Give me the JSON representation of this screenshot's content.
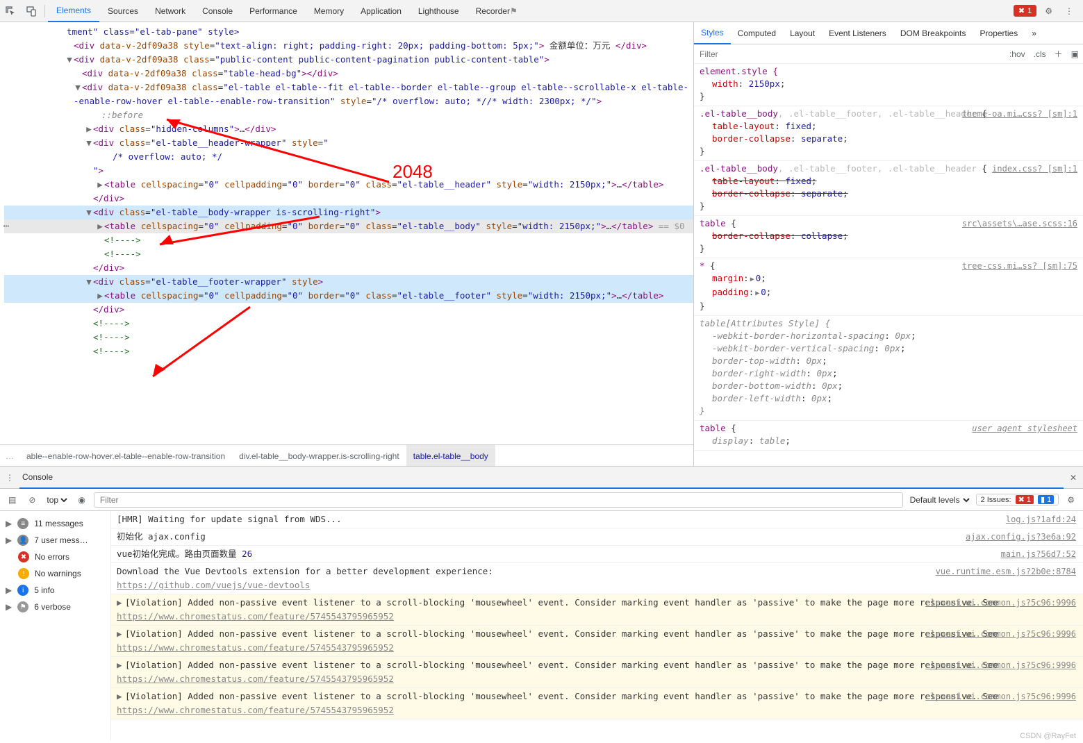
{
  "toolbar": {
    "tabs": [
      "Elements",
      "Sources",
      "Network",
      "Console",
      "Performance",
      "Memory",
      "Application",
      "Lighthouse",
      "Recorder"
    ],
    "active_tab": 0,
    "error_count": "1"
  },
  "annotation": {
    "label": "2048"
  },
  "dom": {
    "l0": "tment\" class=\"el-tab-pane\" style>",
    "l1_open": "<div data-v-2df09a38 style=\"text-align: right; padding-right: 20px; padding-bottom: 5px;\">",
    "l1_text": " 金额单位：万元 ",
    "l1_close": "</div>",
    "l2": "<div data-v-2df09a38 class=\"public-content public-content-pagination public-content-table\">",
    "l3": "<div data-v-2df09a38 class=\"table-head-bg\"></div>",
    "l4": "<div data-v-2df09a38 class=\"el-table el-table--fit el-table--border el-table--group el-table--scrollable-x el-table--enable-row-hover el-table--enable-row-transition\" style=\"/* overflow: auto; *//* width: 2300px; */\">",
    "before": "::before",
    "l5": "<div class=\"hidden-columns\">…</div>",
    "l6": "<div class=\"el-table__header-wrapper\" style=\"",
    "l6b": "/* overflow: auto; */",
    "l6c": "\">",
    "l7": "<table cellspacing=\"0\" cellpadding=\"0\" border=\"0\" class=\"el-table__header\" style=\"width: 2150px;\">…</table>",
    "l8": "</div>",
    "l9": "<div class=\"el-table__body-wrapper is-scrolling-right\">",
    "l10": "<table cellspacing=\"0\" cellpadding=\"0\" border=\"0\" class=\"el-table__body\" style=\"width: 2150px;\">…</table>",
    "l10_suffix": " == $0",
    "cmt": "<!---->",
    "l13": "<div class=\"el-table__footer-wrapper\" style>",
    "l14": "<table cellspacing=\"0\" cellpadding=\"0\" border=\"0\" class=\"el-table__footer\" style=\"width: 2150px;\">…</table>"
  },
  "crumbs": {
    "a": "able--enable-row-hover.el-table--enable-row-transition",
    "b": "div.el-table__body-wrapper.is-scrolling-right",
    "c": "table.el-table__body"
  },
  "styles": {
    "tabs": [
      "Styles",
      "Computed",
      "Layout",
      "Event Listeners",
      "DOM Breakpoints",
      "Properties"
    ],
    "filter_ph": "Filter",
    "hov": ":hov",
    "cls": ".cls",
    "rule_elem_sel": "element.style {",
    "rule_elem_p1": "width",
    "rule_elem_v1": "2150px",
    "brace_close": "}",
    "r2_src": "theme-oa.mi…css? [sm]:1",
    "r2_sel": ".el-table__body",
    "r2_sel_dim": ", .el-table__footer, .el-table__header",
    "r2_open": " {",
    "r2_p1": "table-layout",
    "r2_v1": "fixed",
    "r2_p2": "border-collapse",
    "r2_v2": "separate",
    "r3_src": "index.css? [sm]:1",
    "r3_sel": ".el-table__body",
    "r3_sel_dim": ", .el-table__footer, .el-table__header",
    "r3_p1": "table-layout",
    "r3_v1": "fixed",
    "r3_p2": "border-collapse",
    "r3_v2": "separate",
    "r4_src": "src\\assets\\…ase.scss:16",
    "r4_sel": "table",
    "r4_p1": "border-collapse",
    "r4_v1": "collapse",
    "r5_src": "tree-css.mi…ss? [sm]:75",
    "r5_sel": "*",
    "r5_p1": "margin",
    "r5_v1": "0",
    "r5_p2": "padding",
    "r5_v2": "0",
    "r6_sel": "table[Attributes Style]",
    "r6_rows": [
      [
        "-webkit-border-horizontal-spacing",
        "0px"
      ],
      [
        "-webkit-border-vertical-spacing",
        "0px"
      ],
      [
        "border-top-width",
        "0px"
      ],
      [
        "border-right-width",
        "0px"
      ],
      [
        "border-bottom-width",
        "0px"
      ],
      [
        "border-left-width",
        "0px"
      ]
    ],
    "r7_src": "user agent stylesheet",
    "r7_sel": "table",
    "r7_p1": "display",
    "r7_v1": "table"
  },
  "console": {
    "title": "Console",
    "ctx": "top",
    "filter_ph": "Filter",
    "levels": "Default levels",
    "issues_label": "2 Issues:",
    "issues_err": "1",
    "issues_info": "1",
    "side": {
      "messages": "11 messages",
      "user": "7 user mess…",
      "errors": "No errors",
      "warnings": "No warnings",
      "info": "5 info",
      "verbose": "6 verbose"
    },
    "msgs": {
      "m1_t": "[HMR] Waiting for update signal from WDS...",
      "m1_s": "log.js?1afd:24",
      "m2_t": "初始化 ajax.config",
      "m2_s": "ajax.config.js?3e6a:92",
      "m3_t": "vue初始化完成。路由页面数量 ",
      "m3_n": "26",
      "m3_s": "main.js?56d7:52",
      "m4_t": "Download the Vue Devtools extension for a better development experience:",
      "m4_l": "https://github.com/vuejs/vue-devtools",
      "m4_s": "vue.runtime.esm.js?2b0e:8784",
      "viol_t": "[Violation] Added non-passive event listener to a scroll-blocking 'mousewheel' event. Consider marking event handler as 'passive' to make the page more responsive. See ",
      "viol_l": "https://www.chromestatus.com/feature/5745543795965952",
      "viol_s": "element-ui.common.js?5c96:9996"
    }
  },
  "watermark": "CSDN @RayFet"
}
